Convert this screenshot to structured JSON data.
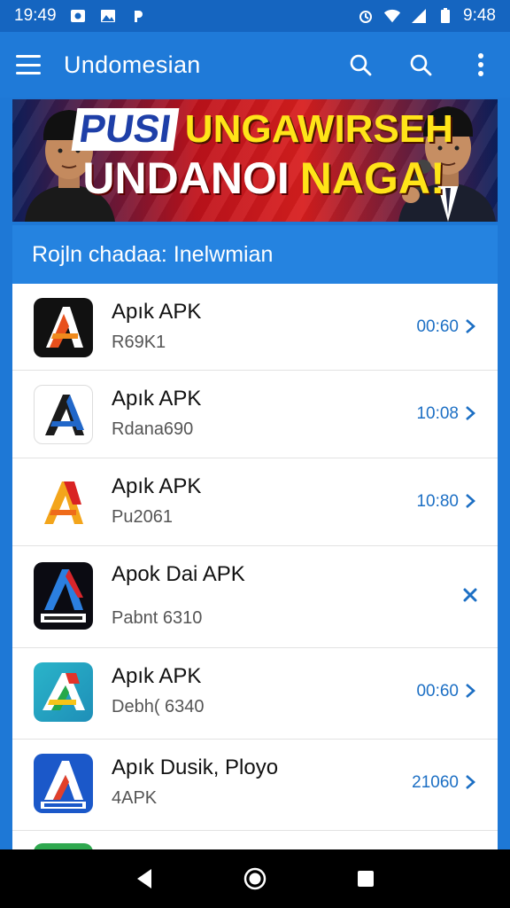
{
  "status_bar": {
    "time_left": "19:49",
    "time_right": "9:48"
  },
  "app_bar": {
    "title": "Undomesian"
  },
  "banner": {
    "line1_a": "PUSI",
    "line1_b": "UNGAWIRSEH",
    "line2_a": "UNDANOI",
    "line2_b": "NAGA!"
  },
  "section": {
    "title": "Rojln chadaa: Inelwmian"
  },
  "list": [
    {
      "title": "Apık APK",
      "subtitle": "R69K1",
      "time": "00:60",
      "action": "chevron",
      "icon": "apk-logo-orange-black-icon"
    },
    {
      "title": "Apık APK",
      "subtitle": "Rdana690",
      "time": "10:08",
      "action": "chevron",
      "icon": "apk-logo-blue-white-icon"
    },
    {
      "title": "Apık APK",
      "subtitle": "Pu2061",
      "time": "10:80",
      "action": "chevron",
      "icon": "apk-logo-yellow-red-icon"
    },
    {
      "title": "Apok Dai APK",
      "subtitle": "Pabnt 6310",
      "time": "",
      "action": "close",
      "icon": "apk-logo-dark-blue-icon"
    },
    {
      "title": "Apık APK",
      "subtitle": "Debh( 6340",
      "time": "00:60",
      "action": "chevron",
      "icon": "apk-logo-teal-multicolor-icon"
    },
    {
      "title": "Apık Dusik, Ployo",
      "subtitle": "4APK",
      "time": "21060",
      "action": "chevron",
      "icon": "apk-logo-blue-red-icon"
    }
  ],
  "colors": {
    "primary": "#1f7ad8",
    "status_bar": "#1565c0",
    "accent_text": "#1c6fc4"
  }
}
